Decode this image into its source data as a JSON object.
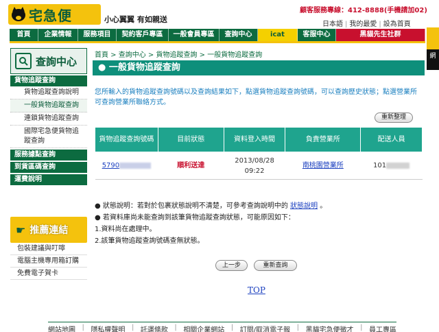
{
  "header": {
    "brand": "宅急便",
    "slogan": "小心翼翼 有如親送",
    "hotline": "顧客服務專線：412-8888(手機請加02)",
    "toplinks": [
      "日本語",
      "我的最愛",
      "設為首頁"
    ]
  },
  "nav": {
    "items": [
      "首頁",
      "企業情報",
      "服務項目",
      "契約客戶專區",
      "一般會員專區",
      "查詢中心",
      "icat",
      "客服中心",
      "黑貓先生社群"
    ]
  },
  "right_ad": {
    "text": "網"
  },
  "sidebar": {
    "title": "查詢中心",
    "sections": [
      {
        "label": "貨物追蹤查詢",
        "subs": [
          "貨物追蹤查詢說明",
          "一般貨物追蹤查詢",
          "連鎖貨物追蹤查詢",
          "國際宅急便貨物追蹤查詢"
        ]
      },
      {
        "label": "服務據點查詢"
      },
      {
        "label": "到貨區碼查詢"
      },
      {
        "label": "運費說明"
      }
    ]
  },
  "promo": {
    "title": "推薦連結",
    "items": [
      "包裝建議與叮嚀",
      "電腦主機專用箱訂購",
      "免費電子賀卡"
    ]
  },
  "breadcrumb": "首頁 > 查詢中心 > 貨物追蹤查詢 > 一般貨物追蹤查詢",
  "page_title": "一般貨物追蹤查詢",
  "description": "您所輸入的貨物追蹤查詢號碼以及查詢結果如下，點選貨物追蹤查詢號碼，可以查詢歷史狀態；點選營業所可查詢營業所聯絡方式。",
  "refresh_label": "重新整理",
  "table": {
    "headers": [
      "貨物追蹤查詢號碼",
      "目前狀態",
      "資料登入時間",
      "負責營業所",
      "配送人員"
    ],
    "rows": [
      {
        "tracking_no": "5790",
        "status": "順利送達",
        "date": "2013/08/28",
        "time": "09:22",
        "office": "南桃園營業所",
        "courier": "101"
      }
    ]
  },
  "notes": {
    "line1_prefix": "● 狀態說明：若對於包裹狀態說明不清楚，可參考查詢說明中的",
    "line1_link": "狀態說明",
    "line1_suffix": "。",
    "line2": "● 若資料庫尚未能查詢到該筆貨物追蹤查詢狀態，可能原因如下：",
    "line3": "1.資料尚在處理中。",
    "line4": "2.該筆貨物追蹤查詢號碼查無狀態。"
  },
  "buttons": {
    "prev": "上一步",
    "requery": "重新查詢"
  },
  "top_link": "TOP",
  "footer": [
    "網站地圖",
    "隱私權聲明",
    "託運條款",
    "相關企業網站",
    "訂閱/取消電子報",
    "黑貓宅急便徵才",
    "員工專區"
  ],
  "colors": {
    "primary_green": "#0c6b40",
    "teal": "#0e8f7b",
    "yellow": "#f4c20d",
    "red": "#c8102e"
  }
}
